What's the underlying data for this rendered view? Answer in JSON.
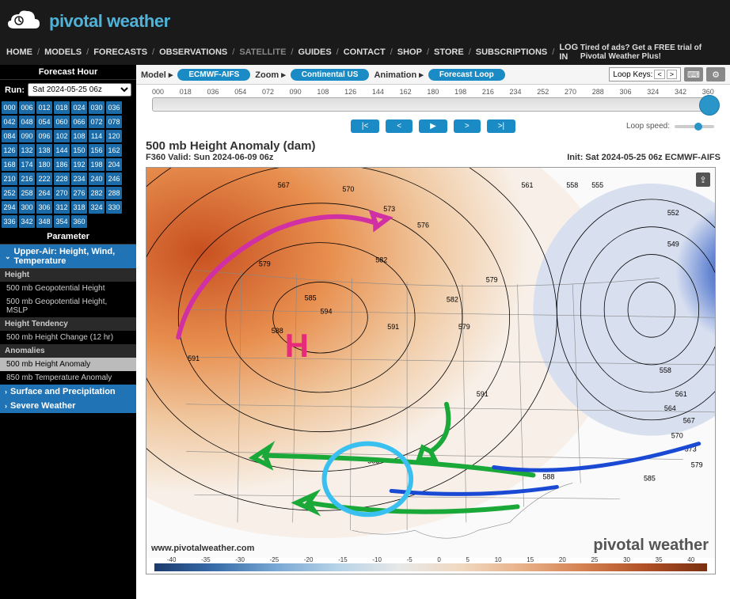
{
  "brand": "pivotal weather",
  "nav": {
    "items": [
      "HOME",
      "MODELS",
      "FORECASTS",
      "OBSERVATIONS",
      "SATELLITE",
      "GUIDES",
      "CONTACT",
      "SHOP",
      "STORE",
      "SUBSCRIPTIONS",
      "LOG IN"
    ],
    "promo": "Tired of ads? Get a FREE trial of Pivotal Weather Plus!"
  },
  "sidebar": {
    "fh_title": "Forecast Hour",
    "run_label": "Run:",
    "run_value": "Sat 2024-05-25 06z",
    "hours": [
      "000",
      "006",
      "012",
      "018",
      "024",
      "030",
      "036",
      "042",
      "048",
      "054",
      "060",
      "066",
      "072",
      "078",
      "084",
      "090",
      "096",
      "102",
      "108",
      "114",
      "120",
      "126",
      "132",
      "138",
      "144",
      "150",
      "156",
      "162",
      "168",
      "174",
      "180",
      "186",
      "192",
      "198",
      "204",
      "210",
      "216",
      "222",
      "228",
      "234",
      "240",
      "246",
      "252",
      "258",
      "264",
      "270",
      "276",
      "282",
      "288",
      "294",
      "300",
      "306",
      "312",
      "318",
      "324",
      "330",
      "336",
      "342",
      "348",
      "354",
      "360"
    ],
    "param_title": "Parameter",
    "param_groups": [
      {
        "header": "Upper-Air: Height, Wind, Temperature",
        "subs": [
          {
            "label": "Height",
            "items": [
              "500 mb Geopotential Height",
              "500 mb Geopotential Height, MSLP"
            ]
          },
          {
            "label": "Height Tendency",
            "items": [
              "500 mb Height Change (12 hr)"
            ]
          },
          {
            "label": "Anomalies",
            "items": [
              "500 mb Height Anomaly",
              "850 mb Temperature Anomaly"
            ]
          }
        ]
      },
      {
        "header": "Surface and Precipitation"
      },
      {
        "header": "Severe Weather"
      }
    ]
  },
  "toolbar": {
    "model_label": "Model ▸",
    "model": "ECMWF-AIFS",
    "zoom_label": "Zoom ▸",
    "zoom": "Continental US",
    "anim_label": "Animation ▸",
    "anim": "Forecast Loop",
    "loop_keys": "Loop Keys:"
  },
  "timeline": {
    "ticks": [
      "000",
      "018",
      "036",
      "054",
      "072",
      "090",
      "108",
      "126",
      "144",
      "162",
      "180",
      "198",
      "216",
      "234",
      "252",
      "270",
      "288",
      "306",
      "324",
      "342",
      "360"
    ],
    "play_first": "|<",
    "play_prev": "<",
    "play_play": "▶",
    "play_next": ">",
    "play_last": ">|",
    "loop_speed": "Loop speed:"
  },
  "chart": {
    "title": "500 mb Height Anomaly (dam)",
    "valid": "F360 Valid: Sun 2024-06-09 06z",
    "init": "Init: Sat 2024-05-25 06z ECMWF-AIFS",
    "watermark_left": "www.pivotalweather.com",
    "watermark_right": "pivotal weather",
    "colorbar_ticks": [
      "-40",
      "-35",
      "-30",
      "-25",
      "-20",
      "-15",
      "-10",
      "-5",
      "0",
      "5",
      "10",
      "15",
      "20",
      "25",
      "30",
      "35",
      "40"
    ],
    "contours": [
      "555",
      "558",
      "561",
      "564",
      "567",
      "570",
      "573",
      "576",
      "579",
      "582",
      "585",
      "588",
      "591",
      "594",
      "552",
      "549"
    ],
    "annotation_H": "H"
  }
}
